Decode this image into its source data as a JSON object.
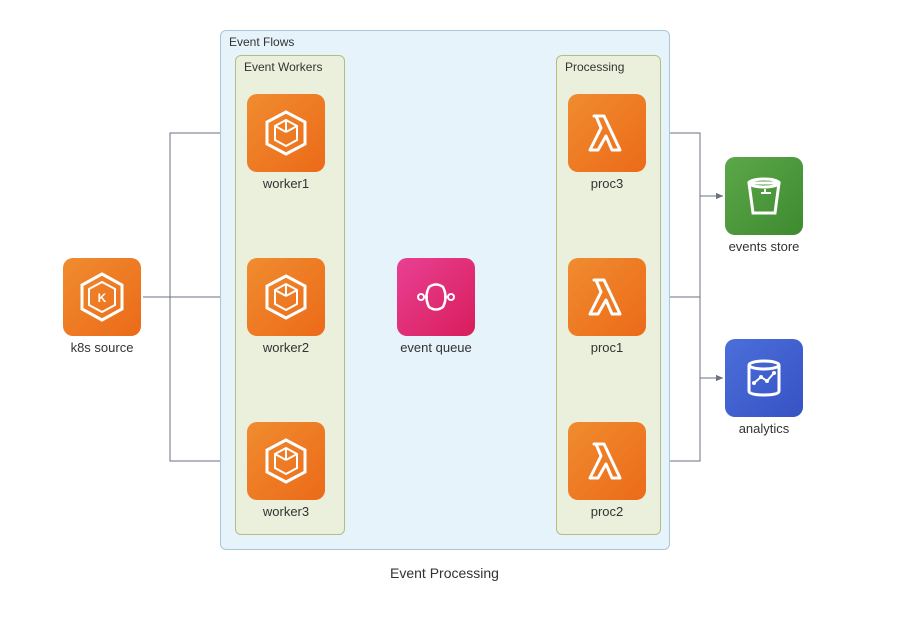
{
  "diagram": {
    "caption": "Event Processing",
    "groups": {
      "eventFlows": {
        "title": "Event Flows"
      },
      "eventWorkers": {
        "title": "Event Workers"
      },
      "processing": {
        "title": "Processing"
      }
    },
    "nodes": {
      "k8sSource": {
        "label": "k8s source"
      },
      "worker1": {
        "label": "worker1"
      },
      "worker2": {
        "label": "worker2"
      },
      "worker3": {
        "label": "worker3"
      },
      "eventQueue": {
        "label": "event queue"
      },
      "proc1": {
        "label": "proc1"
      },
      "proc2": {
        "label": "proc2"
      },
      "proc3": {
        "label": "proc3"
      },
      "eventsStore": {
        "label": "events store"
      },
      "analytics": {
        "label": "analytics"
      }
    },
    "edges": [
      {
        "from": "k8sSource",
        "to": "worker1"
      },
      {
        "from": "k8sSource",
        "to": "worker2"
      },
      {
        "from": "k8sSource",
        "to": "worker3"
      },
      {
        "from": "worker1",
        "to": "eventQueue"
      },
      {
        "from": "worker2",
        "to": "eventQueue"
      },
      {
        "from": "worker3",
        "to": "eventQueue"
      },
      {
        "from": "eventQueue",
        "to": "proc1"
      },
      {
        "from": "eventQueue",
        "to": "proc2"
      },
      {
        "from": "eventQueue",
        "to": "proc3"
      },
      {
        "from": "proc1",
        "to": "eventsStore"
      },
      {
        "from": "proc1",
        "to": "analytics"
      },
      {
        "from": "proc2",
        "to": "eventsStore"
      },
      {
        "from": "proc2",
        "to": "analytics"
      },
      {
        "from": "proc3",
        "to": "eventsStore"
      },
      {
        "from": "proc3",
        "to": "analytics"
      }
    ]
  }
}
